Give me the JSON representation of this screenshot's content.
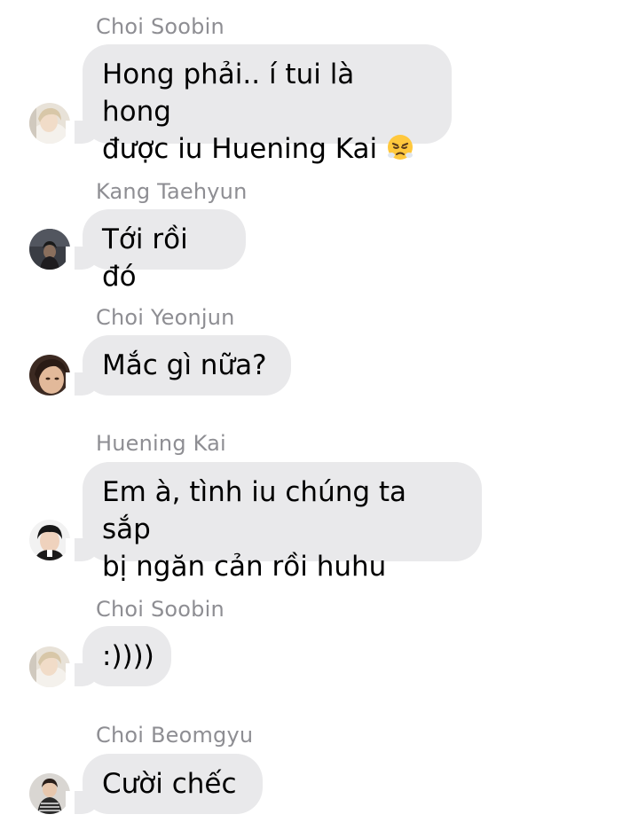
{
  "messages": [
    {
      "sender": "Choi Soobin",
      "line1": "Hong phải.. í tui là hong",
      "line2": "được iu Huening Kai",
      "emoji": "huffing-face-emoji",
      "avatar": "soobin-avatar"
    },
    {
      "sender": "Kang Taehyun",
      "line1": "Tới rồi đó",
      "avatar": "taehyun-avatar"
    },
    {
      "sender": "Choi Yeonjun",
      "line1": "Mắc gì nữa?",
      "avatar": "yeonjun-avatar"
    },
    {
      "sender": "Huening Kai",
      "line1": "Em à, tình iu chúng ta sắp",
      "line2": "bị ngăn cản rồi huhu",
      "avatar": "hueningkai-avatar"
    },
    {
      "sender": "Choi Soobin",
      "line1": ":))))",
      "avatar": "soobin-avatar"
    },
    {
      "sender": "Choi Beomgyu",
      "line1": "Cười chếc",
      "avatar": "beomgyu-avatar"
    }
  ],
  "colors": {
    "bubble": "#e9e9eb",
    "sender_name": "#8e8e93",
    "text": "#000000",
    "background": "#ffffff"
  }
}
